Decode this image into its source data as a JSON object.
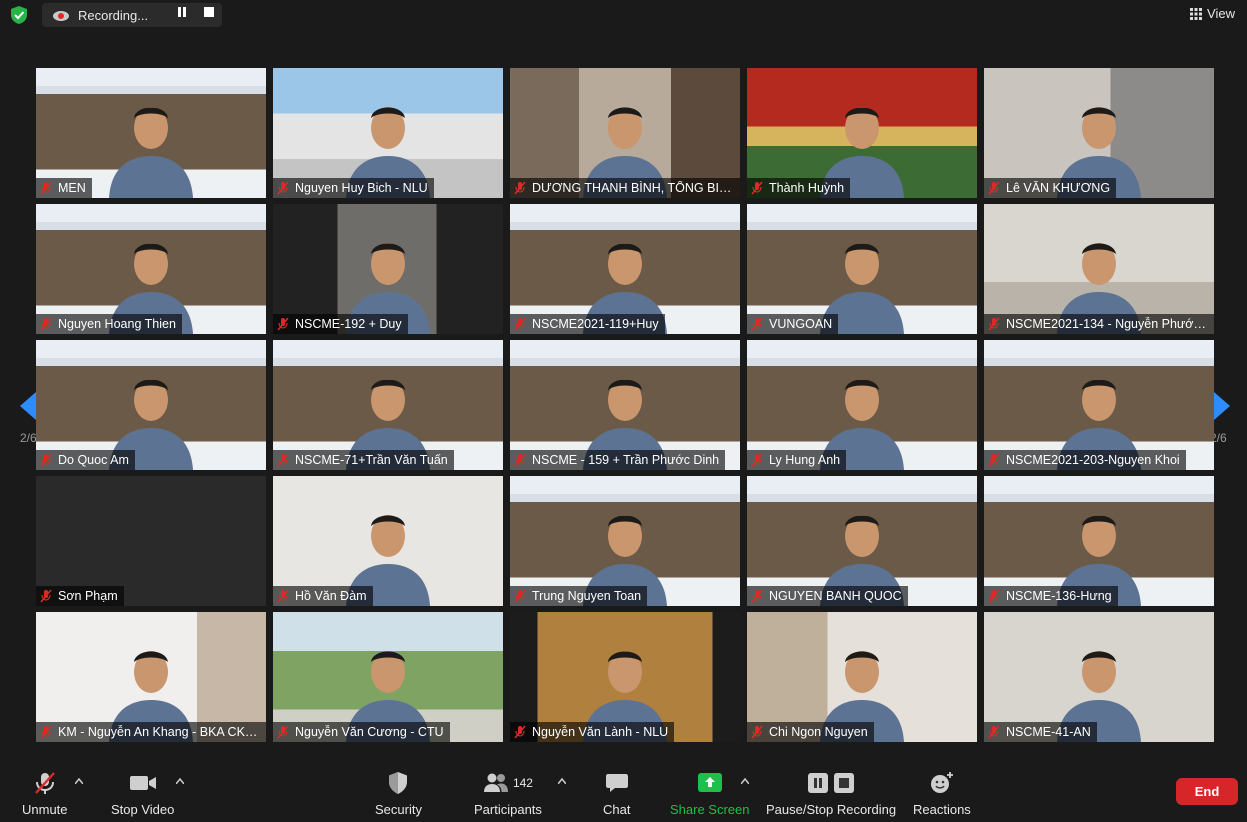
{
  "top_bar": {
    "recording_label": "Recording...",
    "view_label": "View"
  },
  "navigation": {
    "page_left": "2/6",
    "page_right": "2/6"
  },
  "participants": [
    {
      "name": "MEN"
    },
    {
      "name": "Nguyen Huy Bich - NLU"
    },
    {
      "name": "DƯƠNG THANH BÌNH, TỔNG BIÊ..."
    },
    {
      "name": "Thành Huỳnh"
    },
    {
      "name": "Lê VĂN KHƯƠNG"
    },
    {
      "name": "Nguyen Hoang Thien"
    },
    {
      "name": "NSCME-192 + Duy"
    },
    {
      "name": "NSCME2021-119+Huy"
    },
    {
      "name": "VUNGOAN"
    },
    {
      "name": "NSCME2021-134 - Nguyễn Phước..."
    },
    {
      "name": "Do Quoc Am"
    },
    {
      "name": "NSCME-71+Trần Văn Tuấn"
    },
    {
      "name": "NSCME - 159 + Trần Phước Dinh"
    },
    {
      "name": "Ly Hung Anh"
    },
    {
      "name": "NSCME2021-203-Nguyen Khoi"
    },
    {
      "name": "Sơn Phạm"
    },
    {
      "name": "Hồ Văn Đàm"
    },
    {
      "name": "Trung Nguyen Toan"
    },
    {
      "name": "NGUYEN BANH QUOC"
    },
    {
      "name": "NSCME-136-Hưng"
    },
    {
      "name": "KM - Nguyễn An Khang - BKA CK -..."
    },
    {
      "name": "Nguyễn Văn Cương - CTU"
    },
    {
      "name": "Nguyễn Văn Lành - NLU"
    },
    {
      "name": "Chi Ngon Nguyen"
    },
    {
      "name": "NSCME-41-AN"
    }
  ],
  "toolbar": {
    "unmute": "Unmute",
    "stop_video": "Stop Video",
    "security": "Security",
    "participants": "Participants",
    "participants_count": "142",
    "chat": "Chat",
    "share_screen": "Share Screen",
    "pause_stop_recording": "Pause/Stop Recording",
    "reactions": "Reactions",
    "end": "End"
  },
  "colors": {
    "background": "#1a1a1a",
    "end_button": "#d7262a",
    "share_green": "#1fbf4c",
    "nav_arrow": "#2d8cff",
    "mic_muted": "#e02828"
  }
}
